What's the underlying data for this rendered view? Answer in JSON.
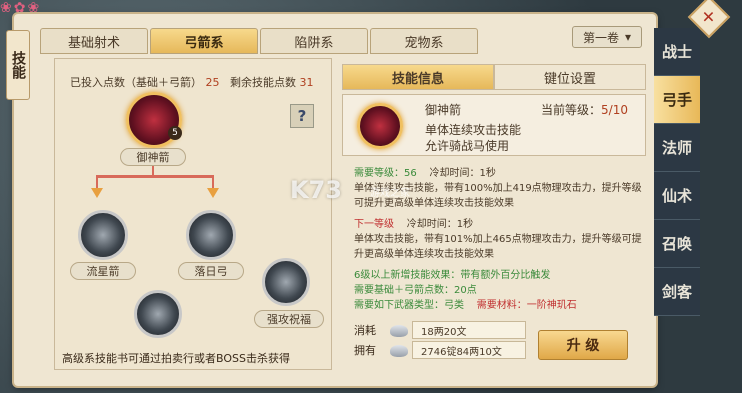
{
  "window": {
    "side_scroll_label": "技能",
    "close_label": "✕",
    "watermark_main": "K73",
    "watermark_sub": "游戏之家",
    "blossom": "❀✿❀"
  },
  "tabs": [
    "基础射术",
    "弓箭系",
    "陷阱系",
    "宠物系"
  ],
  "active_tab": 1,
  "volume": {
    "label": "第一卷",
    "arrow": "▾"
  },
  "points": {
    "invested_label": "已投入点数（基础＋弓箭）",
    "invested": "25",
    "remaining_label": "剩余技能点数",
    "remaining": "31"
  },
  "help_label": "?",
  "skills": [
    {
      "name": "御神箭",
      "level_badge": "5"
    },
    {
      "name": "流星箭"
    },
    {
      "name": "落日弓"
    },
    {
      "name": "强攻祝福"
    },
    {
      "name": ""
    }
  ],
  "bottom_note": "高级系技能书可通过拍卖行或者BOSS击杀获得",
  "right_tabs": [
    "技能信息",
    "键位设置"
  ],
  "skill_info": {
    "name": "御神箭",
    "level_label": "当前等级：",
    "level": "5/10",
    "desc1": "单体连续攻击技能",
    "desc2": "允许骑战马使用"
  },
  "detail": {
    "req_level_label": "需要等级：",
    "req_level": "56",
    "cooldown_label": "冷却时间：",
    "cooldown": "1秒",
    "cur_effect": "单体连续攻击技能，带有100%加上419点物理攻击力，提升等级可提升更高级单体连续攻击技能效果",
    "next_label": "下一等级",
    "next_cooldown": "1秒",
    "next_effect": "单体攻击技能，带有101%加上465点物理攻击力，提升等级可提升更高级单体连续攻击技能效果",
    "tier_note": "6级以上新增技能效果：带有额外百分比触发",
    "req_points": "需要基础＋弓箭点数：20点",
    "req_weapon": "需要如下武器类型：弓类",
    "req_material": "需要材料：一阶神玑石"
  },
  "cost": {
    "consume_label": "消耗",
    "consume": "18两20文",
    "own_label": "拥有",
    "own": "2746锭84两10文"
  },
  "upgrade_label": "升 级",
  "side_nav": [
    "战士",
    "弓手",
    "法师",
    "仙术",
    "召唤",
    "剑客"
  ],
  "active_side": 1
}
